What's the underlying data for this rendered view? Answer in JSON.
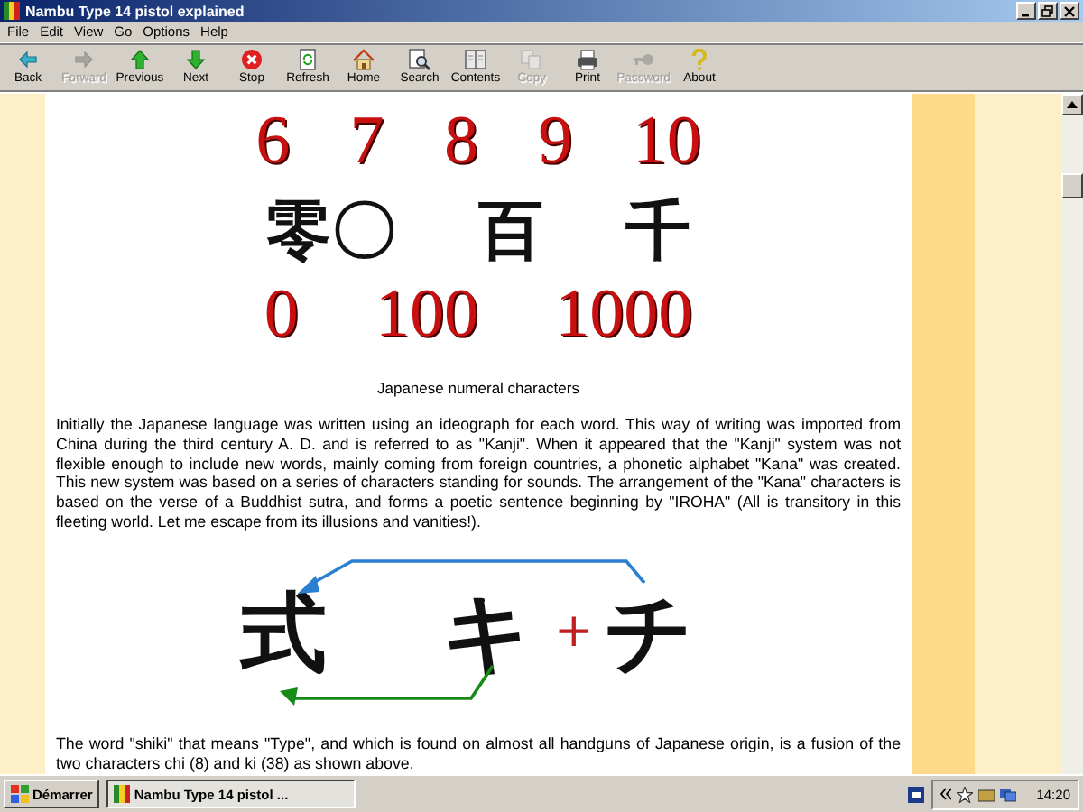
{
  "window": {
    "title": "Nambu Type 14 pistol explained"
  },
  "menu": [
    "File",
    "Edit",
    "View",
    "Go",
    "Options",
    "Help"
  ],
  "toolbar": [
    {
      "label": "Back",
      "disabled": false
    },
    {
      "label": "Forward",
      "disabled": true
    },
    {
      "label": "Previous",
      "disabled": false
    },
    {
      "label": "Next",
      "disabled": false
    },
    {
      "label": "Stop",
      "disabled": false
    },
    {
      "label": "Refresh",
      "disabled": false
    },
    {
      "label": "Home",
      "disabled": false
    },
    {
      "label": "Search",
      "disabled": false
    },
    {
      "label": "Contents",
      "disabled": false
    },
    {
      "label": "Copy",
      "disabled": true
    },
    {
      "label": "Print",
      "disabled": false
    },
    {
      "label": "Password",
      "disabled": true
    },
    {
      "label": "About",
      "disabled": false
    }
  ],
  "numerals_image": {
    "rows": [
      {
        "kind": "digits",
        "items": [
          "6",
          "7",
          "8",
          "9",
          "10"
        ]
      },
      {
        "kind": "kanji",
        "items": [
          "零〇",
          "百",
          "千"
        ]
      },
      {
        "kind": "digits",
        "items": [
          "0",
          "100",
          "1000"
        ]
      }
    ]
  },
  "caption": "Japanese numeral characters",
  "paragraph": "Initially the Japanese language was written using an ideograph for each word. This way of writing was imported from China during the third century A. D. and is referred to as \"Kanji\". When it appeared that the \"Kanji\" system was not flexible enough to include new words, mainly coming from foreign countries, a phonetic alphabet \"Kana\" was created. This new system was based on a series of characters standing for sounds. The arrangement of the \"Kana\" characters is based on the verse of a Buddhist sutra, and forms a poetic sentence beginning by \"IROHA\" (All is transitory in this fleeting world. Let me escape from its illusions and vanities!).",
  "shiki_image": {
    "glyphs": [
      {
        "kind": "glyph",
        "text": "式"
      },
      {
        "kind": "glyph",
        "text": "キ"
      },
      {
        "kind": "plus",
        "text": "+"
      },
      {
        "kind": "glyph",
        "text": "チ"
      }
    ]
  },
  "bottom_text": "The word \"shiki\" that means \"Type\", and which is found on almost all handguns of Japanese origin, is a fusion of the two characters chi (8) and ki (38) as shown above.",
  "taskbar": {
    "start": "Démarrer",
    "tasks": [
      {
        "label": "Nambu Type 14 pistol ...",
        "selected": true
      }
    ],
    "clock": "14:20"
  }
}
